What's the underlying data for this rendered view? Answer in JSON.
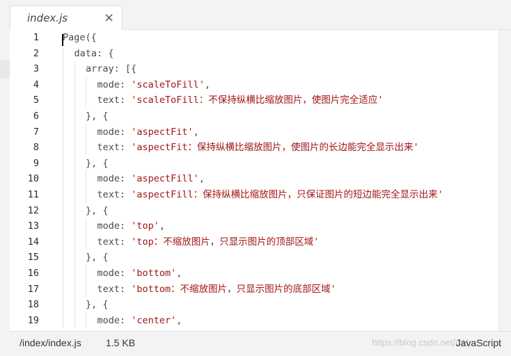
{
  "tab": {
    "name": "index.js",
    "close_label": "×"
  },
  "editor": {
    "lines": [
      {
        "n": "1",
        "indent": 0,
        "parts": [
          [
            "Page({",
            "p"
          ]
        ]
      },
      {
        "n": "2",
        "indent": 1,
        "parts": [
          [
            "data: {",
            "p"
          ]
        ]
      },
      {
        "n": "3",
        "indent": 2,
        "parts": [
          [
            "array: [{",
            "p"
          ]
        ]
      },
      {
        "n": "4",
        "indent": 3,
        "parts": [
          [
            "mode: ",
            "p"
          ],
          [
            "'scaleToFill'",
            "s"
          ],
          [
            ",",
            "p"
          ]
        ]
      },
      {
        "n": "5",
        "indent": 3,
        "parts": [
          [
            "text: ",
            "p"
          ],
          [
            "'scaleToFill：不保持纵横比缩放图片，使图片完全适应'",
            "s"
          ]
        ]
      },
      {
        "n": "6",
        "indent": 2,
        "parts": [
          [
            "}, {",
            "p"
          ]
        ]
      },
      {
        "n": "7",
        "indent": 3,
        "parts": [
          [
            "mode: ",
            "p"
          ],
          [
            "'aspectFit'",
            "s"
          ],
          [
            ",",
            "p"
          ]
        ]
      },
      {
        "n": "8",
        "indent": 3,
        "parts": [
          [
            "text: ",
            "p"
          ],
          [
            "'aspectFit：保持纵横比缩放图片，使图片的长边能完全显示出来'",
            "s"
          ]
        ]
      },
      {
        "n": "9",
        "indent": 2,
        "parts": [
          [
            "}, {",
            "p"
          ]
        ]
      },
      {
        "n": "10",
        "indent": 3,
        "parts": [
          [
            "mode: ",
            "p"
          ],
          [
            "'aspectFill'",
            "s"
          ],
          [
            ",",
            "p"
          ]
        ]
      },
      {
        "n": "11",
        "indent": 3,
        "parts": [
          [
            "text: ",
            "p"
          ],
          [
            "'aspectFill：保持纵横比缩放图片，只保证图片的短边能完全显示出来'",
            "s"
          ]
        ]
      },
      {
        "n": "12",
        "indent": 2,
        "parts": [
          [
            "}, {",
            "p"
          ]
        ]
      },
      {
        "n": "13",
        "indent": 3,
        "parts": [
          [
            "mode: ",
            "p"
          ],
          [
            "'top'",
            "s"
          ],
          [
            ",",
            "p"
          ]
        ]
      },
      {
        "n": "14",
        "indent": 3,
        "parts": [
          [
            "text: ",
            "p"
          ],
          [
            "'top：不缩放图片，只显示图片的顶部区域'",
            "s"
          ]
        ]
      },
      {
        "n": "15",
        "indent": 2,
        "parts": [
          [
            "}, {",
            "p"
          ]
        ]
      },
      {
        "n": "16",
        "indent": 3,
        "parts": [
          [
            "mode: ",
            "p"
          ],
          [
            "'bottom'",
            "s"
          ],
          [
            ",",
            "p"
          ]
        ]
      },
      {
        "n": "17",
        "indent": 3,
        "parts": [
          [
            "text: ",
            "p"
          ],
          [
            "'bottom：不缩放图片，只显示图片的底部区域'",
            "s"
          ]
        ]
      },
      {
        "n": "18",
        "indent": 2,
        "parts": [
          [
            "}, {",
            "p"
          ]
        ]
      },
      {
        "n": "19",
        "indent": 3,
        "parts": [
          [
            "mode: ",
            "p"
          ],
          [
            "'center'",
            "s"
          ],
          [
            ",",
            "p"
          ]
        ]
      }
    ]
  },
  "status": {
    "path": "/index/index.js",
    "size": "1.5 KB",
    "language": "JavaScript",
    "watermark": "https://blog.csdn.net/CH..."
  },
  "colors": {
    "string": "#a31515",
    "text": "#333333"
  }
}
